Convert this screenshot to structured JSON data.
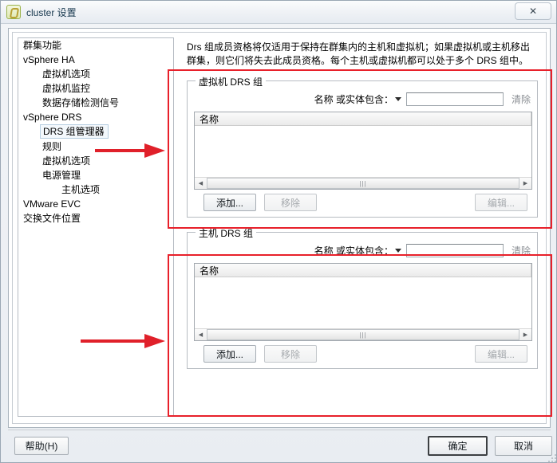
{
  "window": {
    "title": "cluster 设置",
    "icon": "cluster-icon",
    "close_label": "✕"
  },
  "sidebar": {
    "items": [
      {
        "label": "群集功能",
        "level": 1,
        "selected": false
      },
      {
        "label": "vSphere HA",
        "level": 1,
        "selected": false
      },
      {
        "label": "虚拟机选项",
        "level": 2,
        "selected": false
      },
      {
        "label": "虚拟机监控",
        "level": 2,
        "selected": false
      },
      {
        "label": "数据存储检测信号",
        "level": 2,
        "selected": false
      },
      {
        "label": "vSphere DRS",
        "level": 1,
        "selected": false
      },
      {
        "label": "DRS 组管理器",
        "level": 2,
        "selected": true
      },
      {
        "label": "规则",
        "level": 2,
        "selected": false
      },
      {
        "label": "虚拟机选项",
        "level": 2,
        "selected": false
      },
      {
        "label": "电源管理",
        "level": 2,
        "selected": false
      },
      {
        "label": "主机选项",
        "level": 3,
        "selected": false
      },
      {
        "label": "VMware EVC",
        "level": 1,
        "selected": false
      },
      {
        "label": "交换文件位置",
        "level": 1,
        "selected": false
      }
    ]
  },
  "main": {
    "description": "Drs 组成员资格将仅适用于保持在群集内的主机和虚拟机；如果虚拟机或主机移出群集，则它们将失去此成员资格。每个主机或虚拟机都可以处于多个 DRS 组中。",
    "vm_group": {
      "title": "虚拟机 DRS 组",
      "filter_label": "名称 或实体包含：",
      "filter_value": "",
      "clear_label": "清除",
      "column_name": "名称",
      "rows": [],
      "add_label": "添加...",
      "remove_label": "移除",
      "edit_label": "编辑..."
    },
    "host_group": {
      "title": "主机 DRS 组",
      "filter_label": "名称 或实体包含：",
      "filter_value": "",
      "clear_label": "清除",
      "column_name": "名称",
      "rows": [],
      "add_label": "添加...",
      "remove_label": "移除",
      "edit_label": "编辑..."
    }
  },
  "footer": {
    "help_label": "帮助(H)",
    "ok_label": "确定",
    "cancel_label": "取消"
  },
  "annotations": {
    "highlight_color": "#e8202a",
    "arrow_color": "#e0202a",
    "boxes": 2,
    "arrows": 2
  },
  "scrollbar": {
    "left_arrow": "◀",
    "right_arrow": "▶",
    "grip": "|||"
  }
}
